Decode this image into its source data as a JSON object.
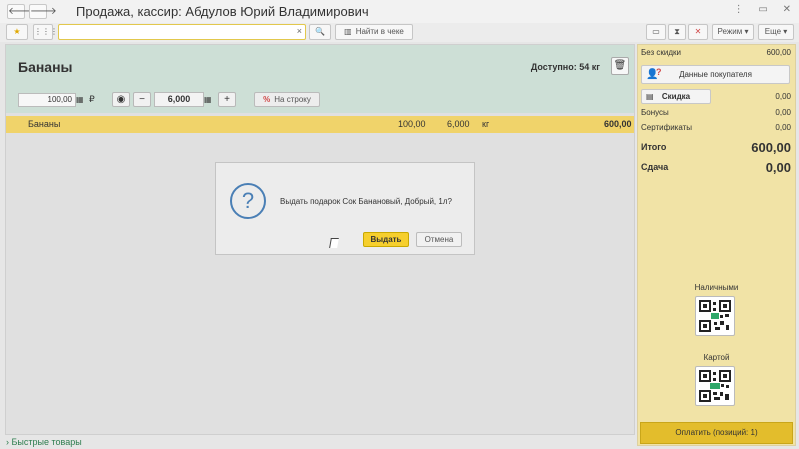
{
  "window": {
    "title": "Продажа, кассир: Абдулов Юрий Владимирович",
    "back_icon": "arrow-left-icon",
    "forward_icon": "arrow-right-icon",
    "menu_icons": [
      "⋮",
      "▭",
      "✕"
    ]
  },
  "toolbar": {
    "search_value": "",
    "clear_glyph": "×",
    "find_in_receipt_label": "Найти в чеке",
    "mode_label": "Режим",
    "more_label": "Еще"
  },
  "product": {
    "name": "Бананы",
    "available": "Доступно: 54 кг",
    "price": "100,00",
    "currency": "₽",
    "quantity": "6,000",
    "minus_label": "−",
    "plus_label": "+",
    "to_row_label": "На строку",
    "to_row_pct": "%"
  },
  "items": [
    {
      "name": "Бананы",
      "price": "100,00",
      "qty": "6,000",
      "unit": "кг",
      "sum": "600,00"
    }
  ],
  "dialog": {
    "icon_glyph": "?",
    "message": "Выдать подарок Сок Банановый, Добрый, 1л?",
    "ok_label": "Выдать",
    "cancel_label": "Отмена"
  },
  "quick_goods_label": "Быстрые товары",
  "summary": {
    "no_discount_label": "Без скидки",
    "no_discount_value": "600,00",
    "buyer_label": "Данные покупателя",
    "buyer_icon_q": "?",
    "discount_label": "Скидка",
    "discount_value": "0,00",
    "bonus_label": "Бонусы",
    "bonus_value": "0,00",
    "certificates_label": "Сертификаты",
    "certificates_value": "0,00",
    "total_label": "Итого",
    "total_value": "600,00",
    "change_label": "Сдача",
    "change_value": "0,00",
    "cash_label": "Наличными",
    "card_label": "Картой",
    "pay_label": "Оплатить (позиций: 1)"
  },
  "colors": {
    "accent_yellow": "#f6cf2d",
    "header_green": "#cddfd6",
    "panel_yellow": "#f1e3a6",
    "pay_button": "#e3bd2c"
  }
}
